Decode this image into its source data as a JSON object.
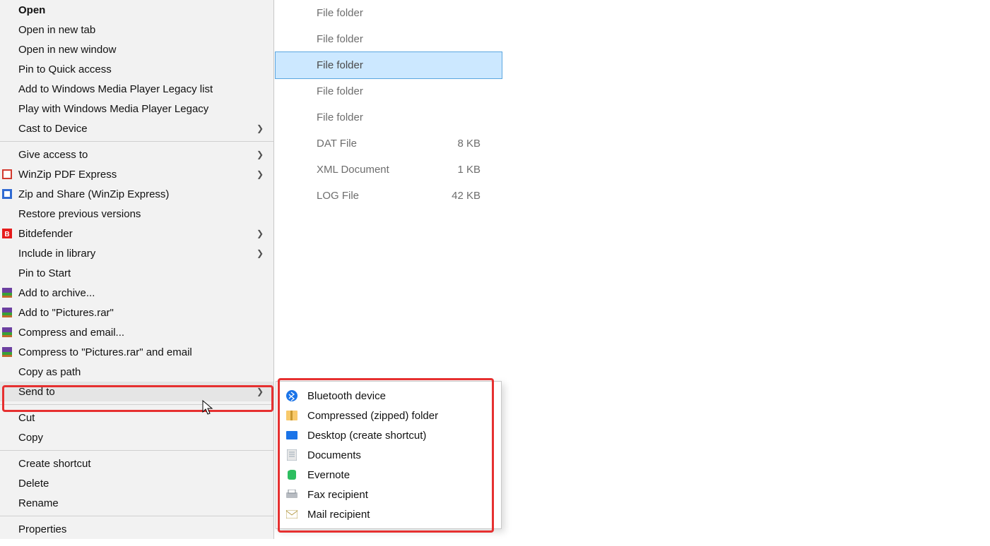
{
  "filelist": {
    "rows": [
      {
        "type": "File folder",
        "size": ""
      },
      {
        "type": "File folder",
        "size": ""
      },
      {
        "type": "File folder",
        "size": "",
        "selected": true
      },
      {
        "type": "File folder",
        "size": ""
      },
      {
        "type": "File folder",
        "size": ""
      },
      {
        "type": "DAT File",
        "size": "8 KB"
      },
      {
        "type": "XML Document",
        "size": "1 KB"
      },
      {
        "type": "LOG File",
        "size": "42 KB"
      }
    ]
  },
  "context_menu": {
    "groups": [
      [
        {
          "label": "Open",
          "bold": true
        },
        {
          "label": "Open in new tab"
        },
        {
          "label": "Open in new window"
        },
        {
          "label": "Pin to Quick access"
        },
        {
          "label": "Add to Windows Media Player Legacy list"
        },
        {
          "label": "Play with Windows Media Player Legacy"
        },
        {
          "label": "Cast to Device",
          "submenu": true
        }
      ],
      [
        {
          "label": "Give access to",
          "submenu": true
        },
        {
          "label": "WinZip PDF Express",
          "submenu": true,
          "icon": "winzip-pdf"
        },
        {
          "label": "Zip and Share (WinZip Express)",
          "icon": "winzip"
        },
        {
          "label": "Restore previous versions"
        },
        {
          "label": "Bitdefender",
          "submenu": true,
          "icon": "bitdefender"
        },
        {
          "label": "Include in library",
          "submenu": true
        },
        {
          "label": "Pin to Start"
        },
        {
          "label": "Add to archive...",
          "icon": "rar"
        },
        {
          "label": "Add to \"Pictures.rar\"",
          "icon": "rar"
        },
        {
          "label": "Compress and email...",
          "icon": "rar"
        },
        {
          "label": "Compress to \"Pictures.rar\" and email",
          "icon": "rar"
        },
        {
          "label": "Copy as path"
        },
        {
          "label": "Send to",
          "submenu": true,
          "hovered": true
        }
      ],
      [
        {
          "label": "Cut"
        },
        {
          "label": "Copy"
        }
      ],
      [
        {
          "label": "Create shortcut"
        },
        {
          "label": "Delete"
        },
        {
          "label": "Rename"
        }
      ],
      [
        {
          "label": "Properties"
        }
      ]
    ]
  },
  "send_to_menu": {
    "items": [
      {
        "label": "Bluetooth device",
        "icon": "bluetooth"
      },
      {
        "label": "Compressed (zipped) folder",
        "icon": "zip"
      },
      {
        "label": "Desktop (create shortcut)",
        "icon": "desktop"
      },
      {
        "label": "Documents",
        "icon": "documents"
      },
      {
        "label": "Evernote",
        "icon": "evernote"
      },
      {
        "label": "Fax recipient",
        "icon": "fax"
      },
      {
        "label": "Mail recipient",
        "icon": "mail"
      }
    ]
  }
}
